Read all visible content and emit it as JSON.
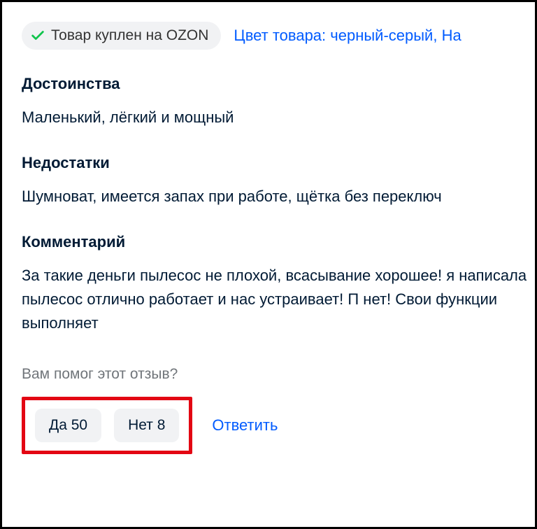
{
  "badge": {
    "label": "Товар куплен на OZON"
  },
  "variant_link": "Цвет товара: черный-серый, На",
  "pros": {
    "title": "Достоинства",
    "text": "Маленький, лёгкий и мощный"
  },
  "cons": {
    "title": "Недостатки",
    "text": "Шумноват, имеется запах при работе, щётка без переключ"
  },
  "comment": {
    "title": "Комментарий",
    "text": "За такие деньги пылесос не плохой, всасывание хорошее! я написала пылесос отлично работает и нас устраивает! П нет! Свои функции выполняет"
  },
  "helpful": {
    "prompt": "Вам помог этот отзыв?",
    "yes_label": "Да",
    "yes_count": 50,
    "no_label": "Нет",
    "no_count": 8
  },
  "reply_label": "Ответить"
}
